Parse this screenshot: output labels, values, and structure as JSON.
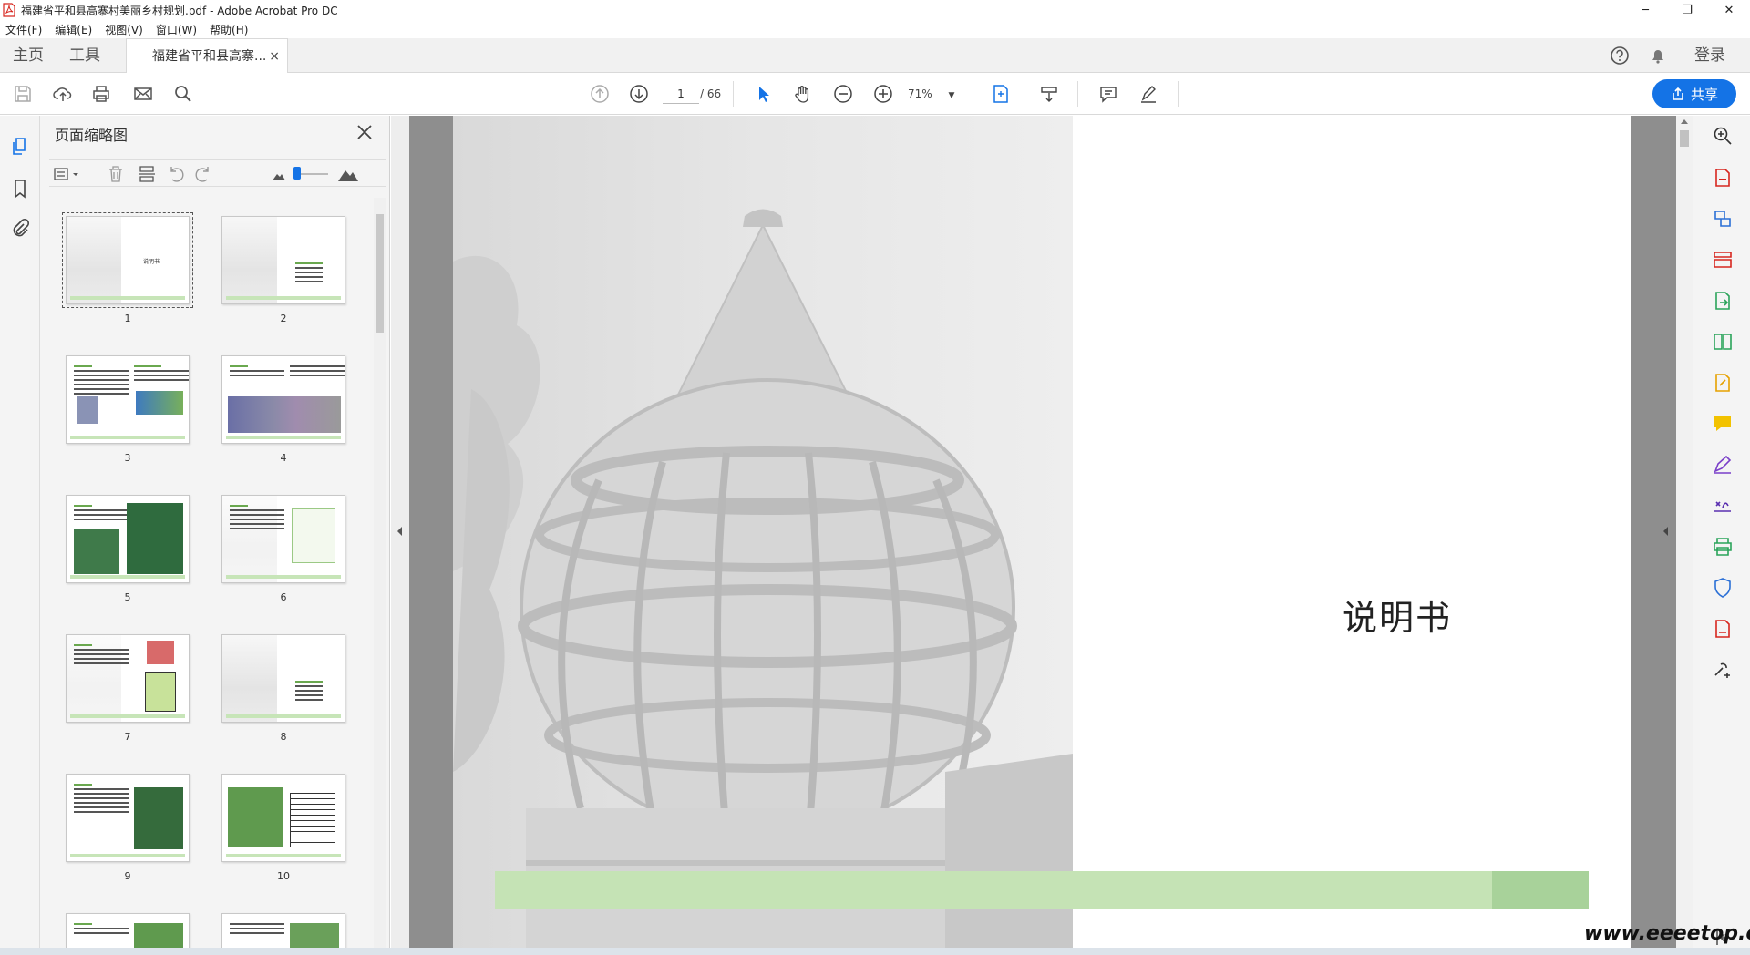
{
  "window": {
    "title": "福建省平和县高寨村美丽乡村规划.pdf - Adobe Acrobat Pro DC",
    "minimize": "─",
    "maximize": "❐",
    "close": "✕"
  },
  "menu": [
    "文件(F)",
    "编辑(E)",
    "视图(V)",
    "窗口(W)",
    "帮助(H)"
  ],
  "tabs": {
    "home": "主页",
    "tools": "工具",
    "document": "福建省平和县高寨...",
    "close": "×",
    "login": "登录"
  },
  "toolbar": {
    "current_page": "1",
    "total_pages": "/ 66",
    "zoom": "71%",
    "share_label": "共享"
  },
  "thumbnail_panel": {
    "title": "页面缩略图",
    "pages": [
      "1",
      "2",
      "3",
      "4",
      "5",
      "6",
      "7",
      "8",
      "9",
      "10"
    ],
    "thumb_caption": "说明书"
  },
  "document": {
    "title": "说明书"
  },
  "watermark": "www.eeeetop.com",
  "colors": {
    "accent": "#1473e6",
    "green_band": "#c5e3b5",
    "green_band_dark": "#a8d29a",
    "adobe_red": "#d7261e"
  }
}
